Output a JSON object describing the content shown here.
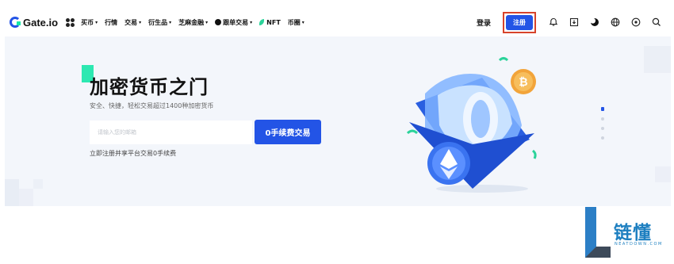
{
  "brand": {
    "logo_text": "Gate.io"
  },
  "nav": {
    "items": [
      {
        "label": "买币",
        "caret": true
      },
      {
        "label": "行情",
        "caret": false
      },
      {
        "label": "交易",
        "caret": true
      },
      {
        "label": "衍生品",
        "caret": true
      },
      {
        "label": "芝麻金融",
        "caret": true
      },
      {
        "label": "跟单交易",
        "caret": true
      },
      {
        "label": "NFT",
        "caret": false
      },
      {
        "label": "币圈",
        "caret": true
      }
    ],
    "caret_glyph": "▾"
  },
  "header_right": {
    "login_label": "登录",
    "register_label": "注册",
    "icons": [
      "bell-icon",
      "download-icon",
      "theme-moon-icon",
      "globe-icon",
      "settings-icon",
      "search-icon"
    ]
  },
  "hero": {
    "title": "加密货币之门",
    "subtitle": "安全、快捷，轻松交易超过1400种加密货币",
    "email_placeholder": "请输入您的邮箱",
    "cta_label": "0手续费交易",
    "promo_text": "立即注册并享平台交易0手续费"
  },
  "carousel": {
    "total": 4,
    "active_index": 0
  },
  "watermark": {
    "brand": "链懂",
    "domain": "NEATDOWN.COM"
  },
  "colors": {
    "accent": "#2354e6",
    "highlight_border": "#d7432b",
    "brand_green": "#17e7a8",
    "hero_bg": "#f3f6fb",
    "watermark_blue": "#1d7fc0"
  }
}
